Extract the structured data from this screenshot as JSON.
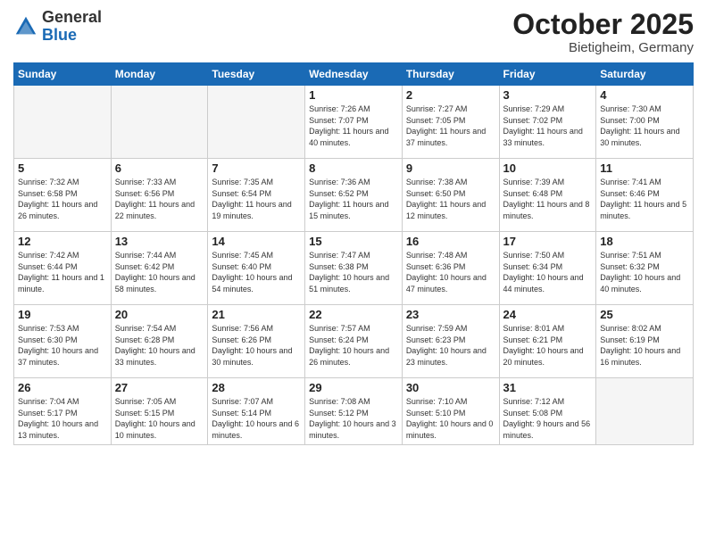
{
  "header": {
    "logo_general": "General",
    "logo_blue": "Blue",
    "month_title": "October 2025",
    "location": "Bietigheim, Germany"
  },
  "weekdays": [
    "Sunday",
    "Monday",
    "Tuesday",
    "Wednesday",
    "Thursday",
    "Friday",
    "Saturday"
  ],
  "days": {
    "d1": {
      "num": "1",
      "sunrise": "7:26 AM",
      "sunset": "7:07 PM",
      "daylight": "11 hours and 40 minutes."
    },
    "d2": {
      "num": "2",
      "sunrise": "7:27 AM",
      "sunset": "7:05 PM",
      "daylight": "11 hours and 37 minutes."
    },
    "d3": {
      "num": "3",
      "sunrise": "7:29 AM",
      "sunset": "7:02 PM",
      "daylight": "11 hours and 33 minutes."
    },
    "d4": {
      "num": "4",
      "sunrise": "7:30 AM",
      "sunset": "7:00 PM",
      "daylight": "11 hours and 30 minutes."
    },
    "d5": {
      "num": "5",
      "sunrise": "7:32 AM",
      "sunset": "6:58 PM",
      "daylight": "11 hours and 26 minutes."
    },
    "d6": {
      "num": "6",
      "sunrise": "7:33 AM",
      "sunset": "6:56 PM",
      "daylight": "11 hours and 22 minutes."
    },
    "d7": {
      "num": "7",
      "sunrise": "7:35 AM",
      "sunset": "6:54 PM",
      "daylight": "11 hours and 19 minutes."
    },
    "d8": {
      "num": "8",
      "sunrise": "7:36 AM",
      "sunset": "6:52 PM",
      "daylight": "11 hours and 15 minutes."
    },
    "d9": {
      "num": "9",
      "sunrise": "7:38 AM",
      "sunset": "6:50 PM",
      "daylight": "11 hours and 12 minutes."
    },
    "d10": {
      "num": "10",
      "sunrise": "7:39 AM",
      "sunset": "6:48 PM",
      "daylight": "11 hours and 8 minutes."
    },
    "d11": {
      "num": "11",
      "sunrise": "7:41 AM",
      "sunset": "6:46 PM",
      "daylight": "11 hours and 5 minutes."
    },
    "d12": {
      "num": "12",
      "sunrise": "7:42 AM",
      "sunset": "6:44 PM",
      "daylight": "11 hours and 1 minute."
    },
    "d13": {
      "num": "13",
      "sunrise": "7:44 AM",
      "sunset": "6:42 PM",
      "daylight": "10 hours and 58 minutes."
    },
    "d14": {
      "num": "14",
      "sunrise": "7:45 AM",
      "sunset": "6:40 PM",
      "daylight": "10 hours and 54 minutes."
    },
    "d15": {
      "num": "15",
      "sunrise": "7:47 AM",
      "sunset": "6:38 PM",
      "daylight": "10 hours and 51 minutes."
    },
    "d16": {
      "num": "16",
      "sunrise": "7:48 AM",
      "sunset": "6:36 PM",
      "daylight": "10 hours and 47 minutes."
    },
    "d17": {
      "num": "17",
      "sunrise": "7:50 AM",
      "sunset": "6:34 PM",
      "daylight": "10 hours and 44 minutes."
    },
    "d18": {
      "num": "18",
      "sunrise": "7:51 AM",
      "sunset": "6:32 PM",
      "daylight": "10 hours and 40 minutes."
    },
    "d19": {
      "num": "19",
      "sunrise": "7:53 AM",
      "sunset": "6:30 PM",
      "daylight": "10 hours and 37 minutes."
    },
    "d20": {
      "num": "20",
      "sunrise": "7:54 AM",
      "sunset": "6:28 PM",
      "daylight": "10 hours and 33 minutes."
    },
    "d21": {
      "num": "21",
      "sunrise": "7:56 AM",
      "sunset": "6:26 PM",
      "daylight": "10 hours and 30 minutes."
    },
    "d22": {
      "num": "22",
      "sunrise": "7:57 AM",
      "sunset": "6:24 PM",
      "daylight": "10 hours and 26 minutes."
    },
    "d23": {
      "num": "23",
      "sunrise": "7:59 AM",
      "sunset": "6:23 PM",
      "daylight": "10 hours and 23 minutes."
    },
    "d24": {
      "num": "24",
      "sunrise": "8:01 AM",
      "sunset": "6:21 PM",
      "daylight": "10 hours and 20 minutes."
    },
    "d25": {
      "num": "25",
      "sunrise": "8:02 AM",
      "sunset": "6:19 PM",
      "daylight": "10 hours and 16 minutes."
    },
    "d26": {
      "num": "26",
      "sunrise": "7:04 AM",
      "sunset": "5:17 PM",
      "daylight": "10 hours and 13 minutes."
    },
    "d27": {
      "num": "27",
      "sunrise": "7:05 AM",
      "sunset": "5:15 PM",
      "daylight": "10 hours and 10 minutes."
    },
    "d28": {
      "num": "28",
      "sunrise": "7:07 AM",
      "sunset": "5:14 PM",
      "daylight": "10 hours and 6 minutes."
    },
    "d29": {
      "num": "29",
      "sunrise": "7:08 AM",
      "sunset": "5:12 PM",
      "daylight": "10 hours and 3 minutes."
    },
    "d30": {
      "num": "30",
      "sunrise": "7:10 AM",
      "sunset": "5:10 PM",
      "daylight": "10 hours and 0 minutes."
    },
    "d31": {
      "num": "31",
      "sunrise": "7:12 AM",
      "sunset": "5:08 PM",
      "daylight": "9 hours and 56 minutes."
    }
  }
}
